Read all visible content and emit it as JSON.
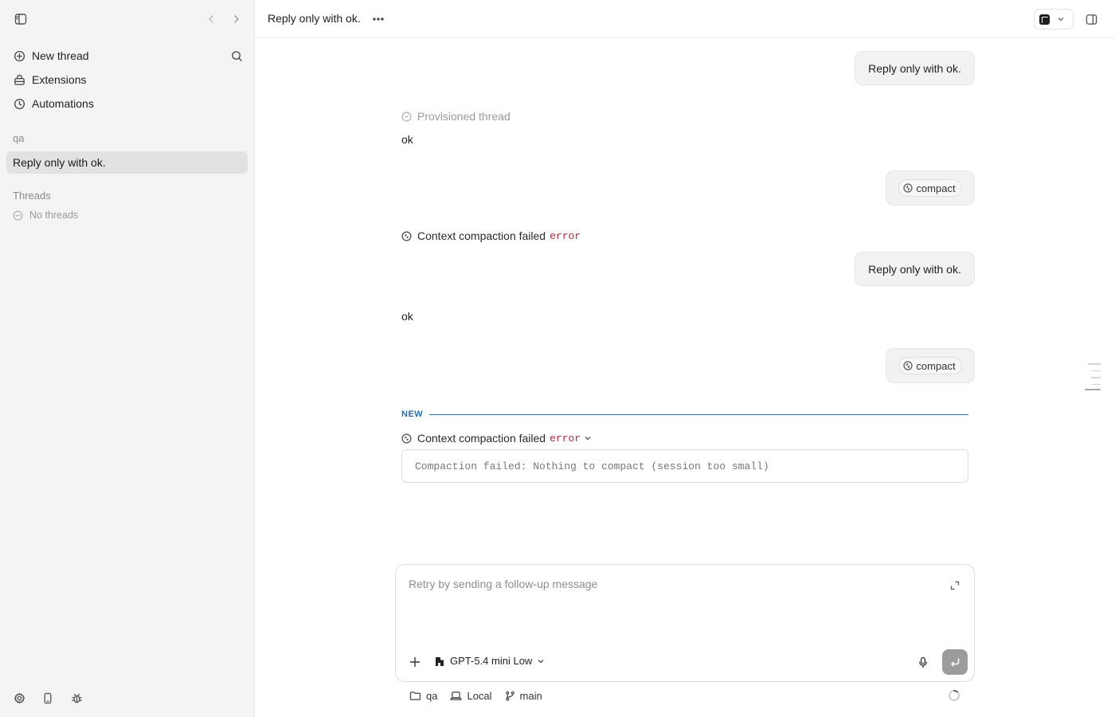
{
  "sidebar": {
    "nav": [
      {
        "label": "New thread",
        "icon": "plus-circle-icon"
      },
      {
        "label": "Extensions",
        "icon": "extensions-icon"
      },
      {
        "label": "Automations",
        "icon": "clock-icon"
      }
    ],
    "project_label": "qa",
    "active_thread": "Reply only with ok.",
    "threads_label": "Threads",
    "no_threads_text": "No threads"
  },
  "header": {
    "title": "Reply only with ok.",
    "more_icon": "ellipsis-icon"
  },
  "conversation": {
    "user_message_1": "Reply only with ok.",
    "provisioned_label": "Provisioned thread",
    "reply_1": "ok",
    "compact_chip_1": "compact",
    "status_1_text": "Context compaction failed",
    "status_1_tag": "error",
    "user_message_2": "Reply only with ok.",
    "reply_2": "ok",
    "compact_chip_2": "compact",
    "new_divider_label": "NEW",
    "status_2_text": "Context compaction failed",
    "status_2_tag": "error",
    "error_detail": "Compaction failed: Nothing to compact (session too small)"
  },
  "composer": {
    "placeholder": "Retry by sending a follow-up message",
    "model_label": "GPT-5.4 mini Low"
  },
  "footer": {
    "folder": "qa",
    "environment": "Local",
    "branch": "main"
  },
  "colors": {
    "accent_blue": "#2d6da3",
    "error_red": "#b0293a",
    "sidebar_bg": "#f4f4f4"
  }
}
